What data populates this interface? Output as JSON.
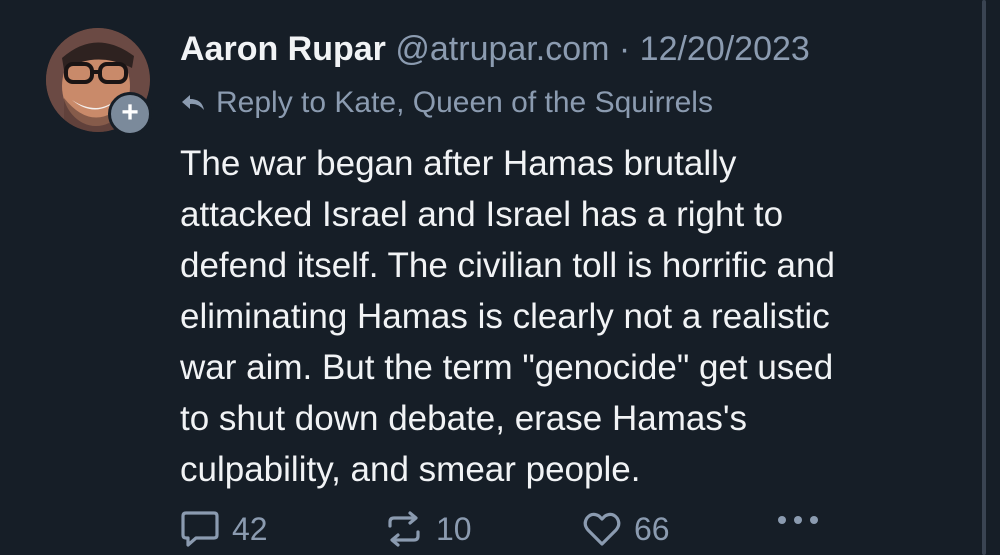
{
  "post": {
    "author_name": "Aaron Rupar",
    "handle": "@atrupar.com",
    "separator": "·",
    "date": "12/20/2023",
    "reply_to": "Reply to Kate, Queen of the Squirrels",
    "text_lines": [
      "The war began after Hamas brutally",
      "attacked Israel and Israel has a right to",
      "defend itself. The civilian toll is horrific and",
      "eliminating Hamas is clearly not a realistic",
      "war aim. But the term \"genocide\" get used",
      "to shut down debate, erase Hamas's",
      "culpability, and smear people."
    ],
    "follow_symbol": "+"
  },
  "actions": {
    "reply_count": "42",
    "repost_count": "10",
    "like_count": "66",
    "more_label": "•••"
  },
  "icons": {
    "reply": "speech-bubble-icon",
    "repost": "repost-arrows-icon",
    "like": "heart-icon",
    "more": "ellipsis-icon",
    "reply_arrow": "reply-arrow-icon"
  },
  "colors": {
    "background": "#161e27",
    "text": "#f1f3f5",
    "muted": "#8b9bb0"
  }
}
